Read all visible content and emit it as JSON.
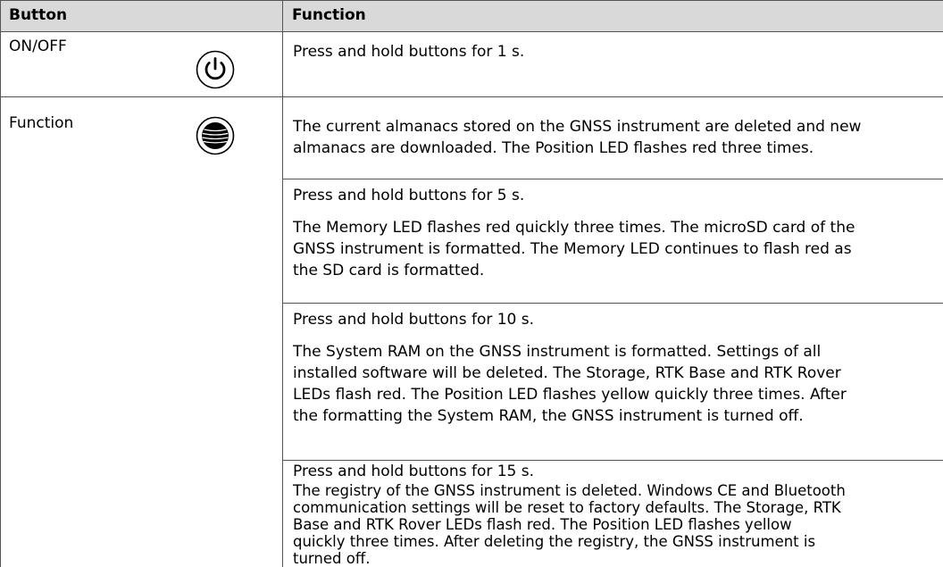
{
  "header": {
    "col_button": "Button",
    "col_function": "Function"
  },
  "rows": [
    {
      "button": "ON/OFF",
      "icon": "power-icon",
      "function_lines": [
        "Press and hold buttons for 1 s."
      ]
    },
    {
      "button": "Function",
      "icon": "function-button-icon",
      "function_lines": [
        "The current almanacs stored on the GNSS instrument are deleted and new",
        "almanacs are downloaded. The Position LED flashes red three times."
      ]
    },
    {
      "title": "Press and hold buttons for 5 s.",
      "lines": [
        "The Memory LED flashes red quickly three times. The microSD card of the",
        "GNSS instrument is formatted. The Memory LED continues to flash red as",
        "the SD card is formatted."
      ]
    },
    {
      "title": "Press and hold buttons for 10 s.",
      "lines": [
        "The System RAM on the GNSS instrument is formatted. Settings of all",
        "installed software will be deleted. The Storage, RTK Base and RTK Rover",
        "LEDs flash red. The Position LED flashes yellow quickly three times. After",
        "the formatting the System RAM, the GNSS instrument is turned off."
      ]
    },
    {
      "title": "Press and hold buttons for 15 s.",
      "lines": [
        "The registry of the GNSS instrument is deleted. Windows CE and Bluetooth",
        "communication settings will be reset to factory defaults. The Storage, RTK",
        "Base and RTK Rover LEDs flash red. The Position LED flashes yellow",
        "quickly three times. After deleting the registry, the GNSS instrument is",
        "turned off."
      ]
    }
  ]
}
